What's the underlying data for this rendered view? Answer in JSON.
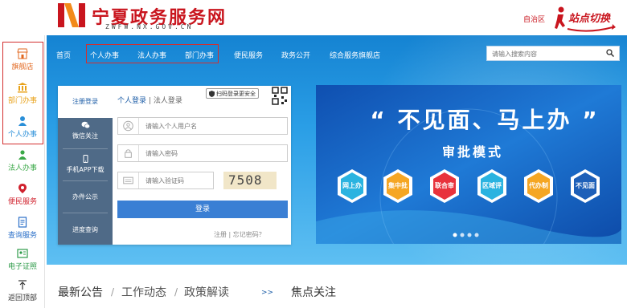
{
  "header": {
    "site_title": "宁夏政务服务网",
    "site_subtitle": "ZWFW.NX.GOV.CN",
    "region_label": "自治区",
    "switch_label": "站点切换",
    "brand_color": "#c9151e"
  },
  "sidebar": {
    "items": [
      {
        "label": "旗舰店",
        "icon": "store-icon"
      },
      {
        "label": "部门办事",
        "icon": "building-icon"
      },
      {
        "label": "个人办事",
        "icon": "person-icon"
      },
      {
        "label": "法人办事",
        "icon": "people-icon"
      },
      {
        "label": "便民服务",
        "icon": "location-icon"
      },
      {
        "label": "查询服务",
        "icon": "document-icon"
      },
      {
        "label": "电子证照",
        "icon": "certificate-icon"
      },
      {
        "label": "返回顶部",
        "icon": "up-arrow-icon"
      }
    ]
  },
  "nav": {
    "items": [
      "首页",
      "个人办事",
      "法人办事",
      "部门办事",
      "便民服务",
      "政务公开",
      "综合服务旗舰店"
    ]
  },
  "search": {
    "placeholder": "请输入搜索内容"
  },
  "login": {
    "tabs": [
      {
        "label": "注册登录",
        "icon": ""
      },
      {
        "label": "微信关注",
        "icon": "wechat-icon"
      },
      {
        "label": "手机APP下载",
        "icon": "phone-icon"
      },
      {
        "label": "办件公示",
        "icon": ""
      },
      {
        "label": "进度查询",
        "icon": ""
      }
    ],
    "tab_personal": "个人登录",
    "tab_divider": "|",
    "tab_corporate": "法人登录",
    "qr_tip": "扫码登录更安全",
    "username_placeholder": "请输入个人用户名",
    "password_placeholder": "请输入密码",
    "captcha_placeholder": "请输入验证码",
    "captcha_code": "7508",
    "submit_label": "登录",
    "links": "注册 | 忘记密码？"
  },
  "slider": {
    "title": "“ 不见面、马上办 ”",
    "subtitle": "审批模式",
    "badges": [
      {
        "label": "网上办",
        "color": "#2ab3e0"
      },
      {
        "label": "集中批",
        "color": "#f5a623"
      },
      {
        "label": "联合审",
        "color": "#e8323c"
      },
      {
        "label": "区域评",
        "color": "#2ab3e0"
      },
      {
        "label": "代办制",
        "color": "#f5a623"
      },
      {
        "label": "不见面",
        "color": "#1d5fb8"
      }
    ]
  },
  "bottom_tabs": {
    "news": "最新公告",
    "work": "工作动态",
    "policy": "政策解读",
    "arrow": ">>",
    "focus": "焦点关注"
  }
}
